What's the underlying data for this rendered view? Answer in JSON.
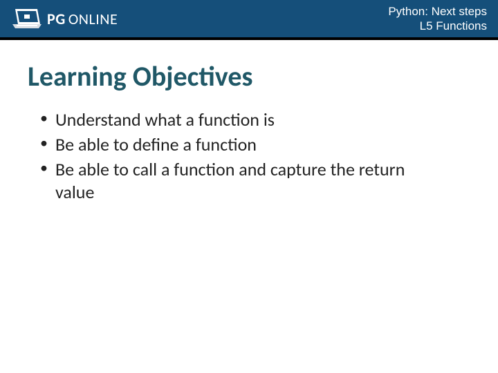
{
  "header": {
    "logo_pg": "PG",
    "logo_online": "ONLINE",
    "course_line1": "Python: Next steps",
    "course_line2": "L5 Functions"
  },
  "main": {
    "heading": "Learning Objectives",
    "bullets": [
      "Understand what a function is",
      "Be able to define a function",
      "Be able to call a function and capture the return value"
    ]
  }
}
